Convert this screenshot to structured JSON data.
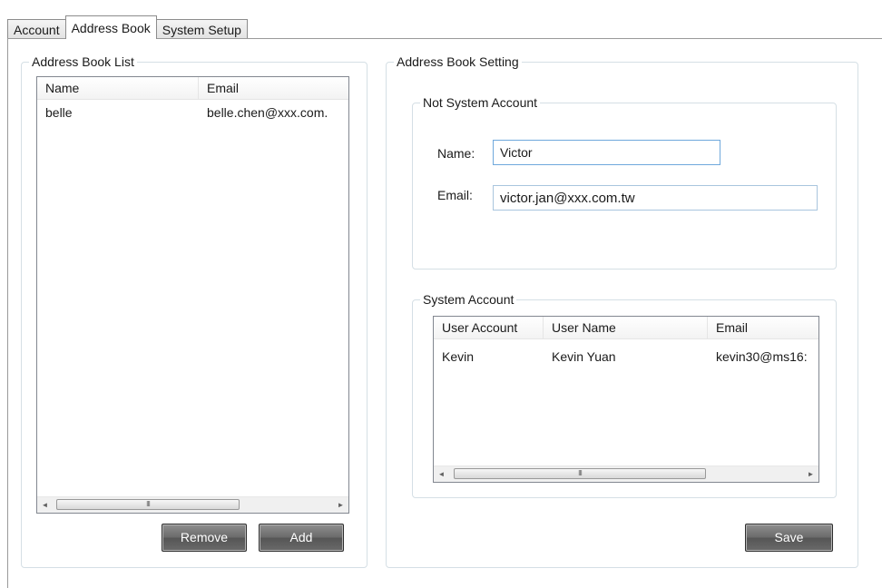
{
  "tabs": [
    {
      "label": "Account"
    },
    {
      "label": "Address Book"
    },
    {
      "label": "System Setup"
    }
  ],
  "active_tab": "Address Book",
  "address_book_list": {
    "title": "Address Book List",
    "columns": [
      "Name",
      "Email"
    ],
    "rows": [
      {
        "name": "belle",
        "email": "belle.chen@xxx.com."
      }
    ],
    "remove_label": "Remove",
    "add_label": "Add"
  },
  "address_book_setting": {
    "title": "Address Book Setting",
    "not_system_account": {
      "title": "Not System Account",
      "name_label": "Name:",
      "name_value": "Victor",
      "email_label": "Email:",
      "email_value": "victor.jan@xxx.com.tw"
    },
    "system_account": {
      "title": "System Account",
      "columns": [
        "User Account",
        "User Name",
        "Email"
      ],
      "rows": [
        {
          "user_account": "Kevin",
          "user_name": "Kevin Yuan",
          "email": "kevin30@ms16:"
        }
      ]
    },
    "save_label": "Save"
  },
  "scrollbar": {
    "left_arrow": "◄",
    "right_arrow": "►",
    "grip": "III"
  }
}
